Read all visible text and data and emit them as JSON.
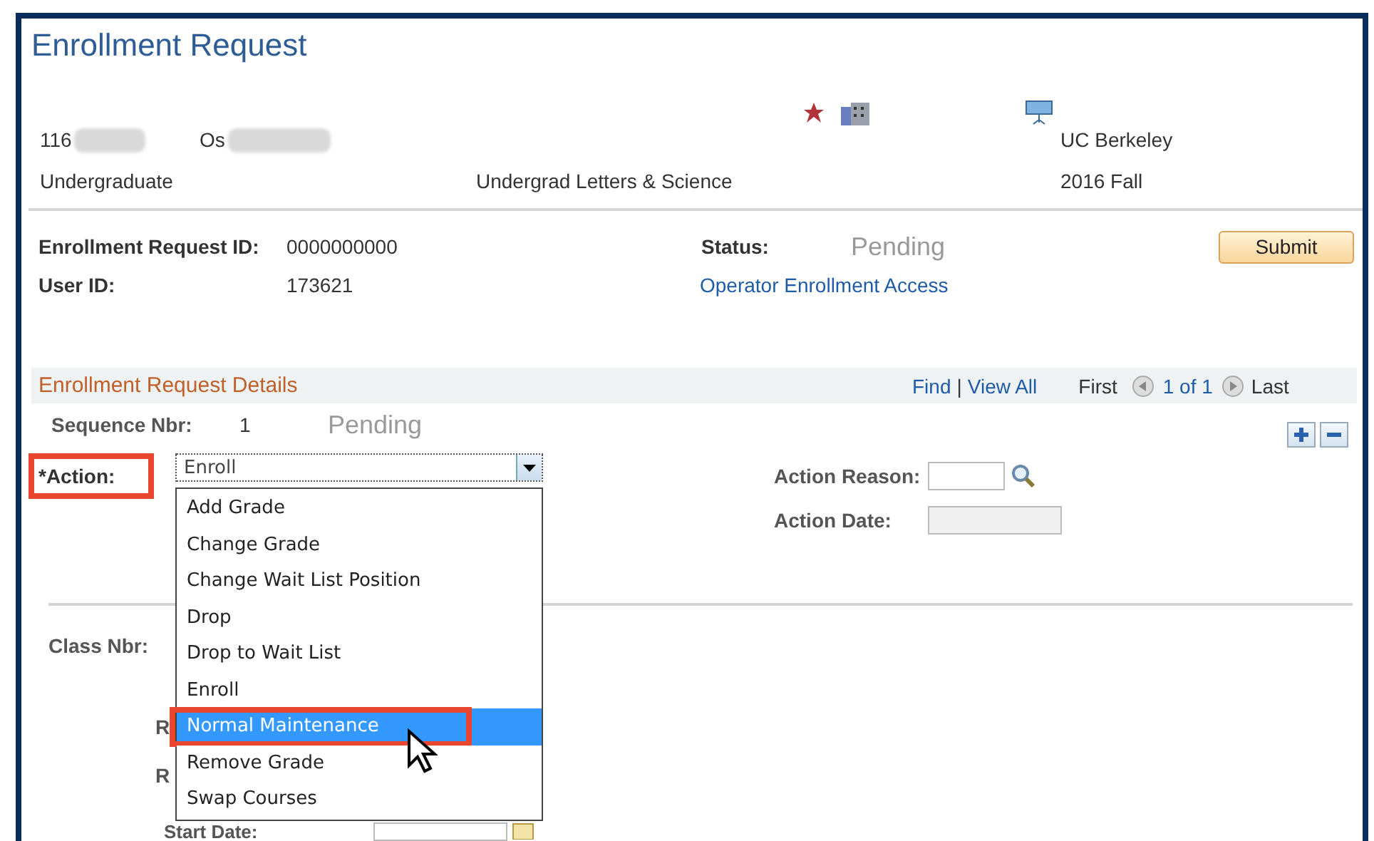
{
  "window": {
    "title": "Enrollment Request"
  },
  "header": {
    "id_prefix": "116",
    "name_prefix": "Os",
    "institution": "UC Berkeley",
    "career": "Undergraduate",
    "program": "Undergrad Letters & Science",
    "term": "2016 Fall"
  },
  "request": {
    "id_label": "Enrollment Request ID:",
    "id_value": "0000000000",
    "status_label": "Status:",
    "status_value": "Pending",
    "user_label": "User ID:",
    "user_value": "173621",
    "access_link": "Operator Enrollment Access",
    "submit": "Submit"
  },
  "details": {
    "title": "Enrollment Request Details",
    "find": "Find",
    "separator": "|",
    "view_all": "View All",
    "first": "First",
    "count": "1 of 1",
    "last": "Last",
    "sequence_label": "Sequence Nbr:",
    "sequence_value": "1",
    "sequence_status": "Pending",
    "action_label": "*Action:",
    "action_highlighted": true,
    "action_value": "Enroll",
    "reason_label": "Action Reason:",
    "date_label": "Action Date:",
    "class_label": "Class Nbr:",
    "covered_labels": [
      "R",
      "R"
    ],
    "start_label": "Start Date:",
    "options": [
      {
        "label": "Add Grade",
        "selected": false,
        "highlighted": false
      },
      {
        "label": "Change Grade",
        "selected": false,
        "highlighted": false
      },
      {
        "label": "Change Wait List Position",
        "selected": false,
        "highlighted": false
      },
      {
        "label": "Drop",
        "selected": false,
        "highlighted": false
      },
      {
        "label": "Drop to Wait List",
        "selected": false,
        "highlighted": false
      },
      {
        "label": "Enroll",
        "selected": false,
        "highlighted": false
      },
      {
        "label": "Normal Maintenance",
        "selected": true,
        "highlighted": true
      },
      {
        "label": "Remove Grade",
        "selected": false,
        "highlighted": false
      },
      {
        "label": "Swap Courses",
        "selected": false,
        "highlighted": false
      }
    ]
  }
}
